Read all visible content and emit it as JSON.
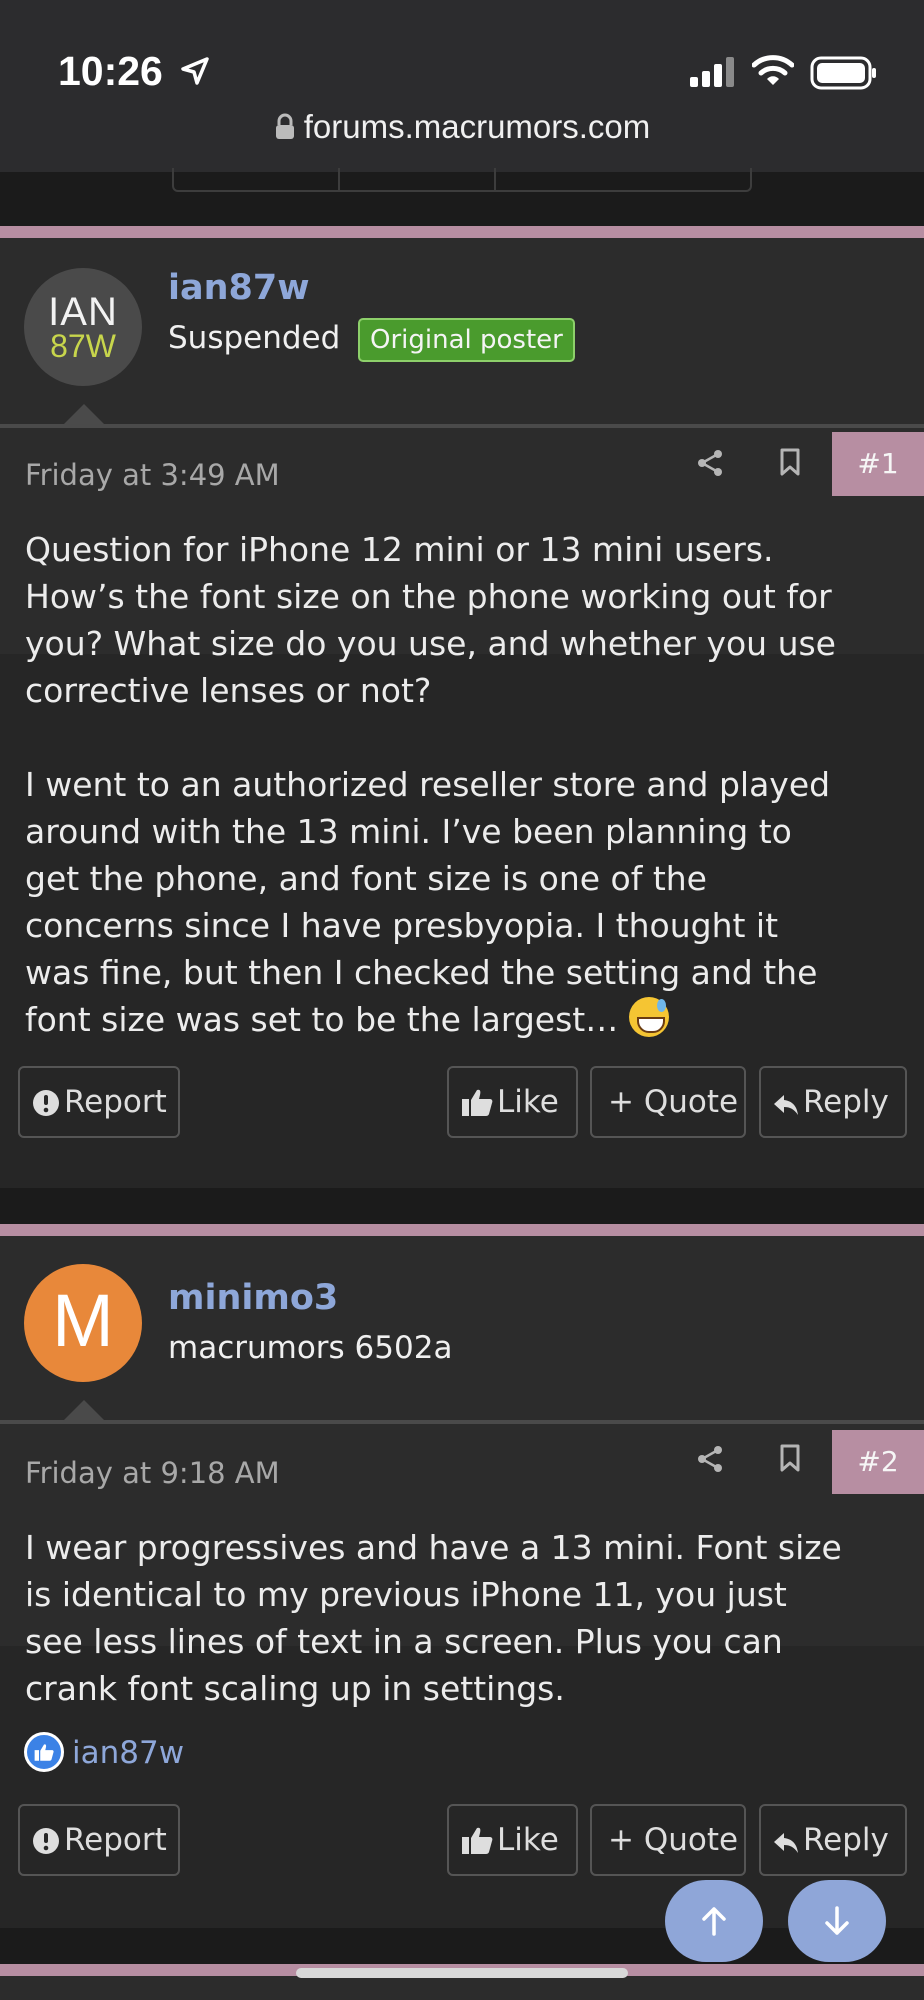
{
  "status_bar": {
    "time": "10:26",
    "url": "forums.macrumors.com"
  },
  "posts": [
    {
      "avatar_line1": "IAN",
      "avatar_line2": "87W",
      "username": "ian87w",
      "user_title": "Suspended",
      "badge": "Original poster",
      "date": "Friday at 3:49 AM",
      "number": "#1",
      "paragraphs": [
        "Question for iPhone 12 mini or 13 mini users.\nHow’s the font size on the phone working out for\nyou? What size do you use, and whether you use\ncorrective lenses or not?",
        "I went to an authorized reseller store and played\naround with the 13 mini. I’ve been planning to\nget the phone, and font size is one of the\nconcerns since I have presbyopia. I thought it\nwas fine, but then I checked the setting and the\nfont size was set to be the largest…"
      ]
    },
    {
      "avatar_letter": "M",
      "username": "minimo3",
      "user_title": "macrumors 6502a",
      "date": "Friday at 9:18 AM",
      "number": "#2",
      "body": "I wear progressives and have a 13 mini. Font size\nis identical to my previous iPhone 11, you just\nsee less lines of text in a screen. Plus you can\ncrank font scaling up in settings.",
      "reaction_user": "ian87w"
    }
  ],
  "actions": {
    "report": "Report",
    "like": "Like",
    "quote": "+ Quote",
    "reply": "Reply"
  },
  "colors": {
    "accent_pink": "#b78ea2",
    "username_blue": "#8ea7d9",
    "badge_green": "#4a9b2d",
    "fab_blue": "#8fa6d8"
  }
}
